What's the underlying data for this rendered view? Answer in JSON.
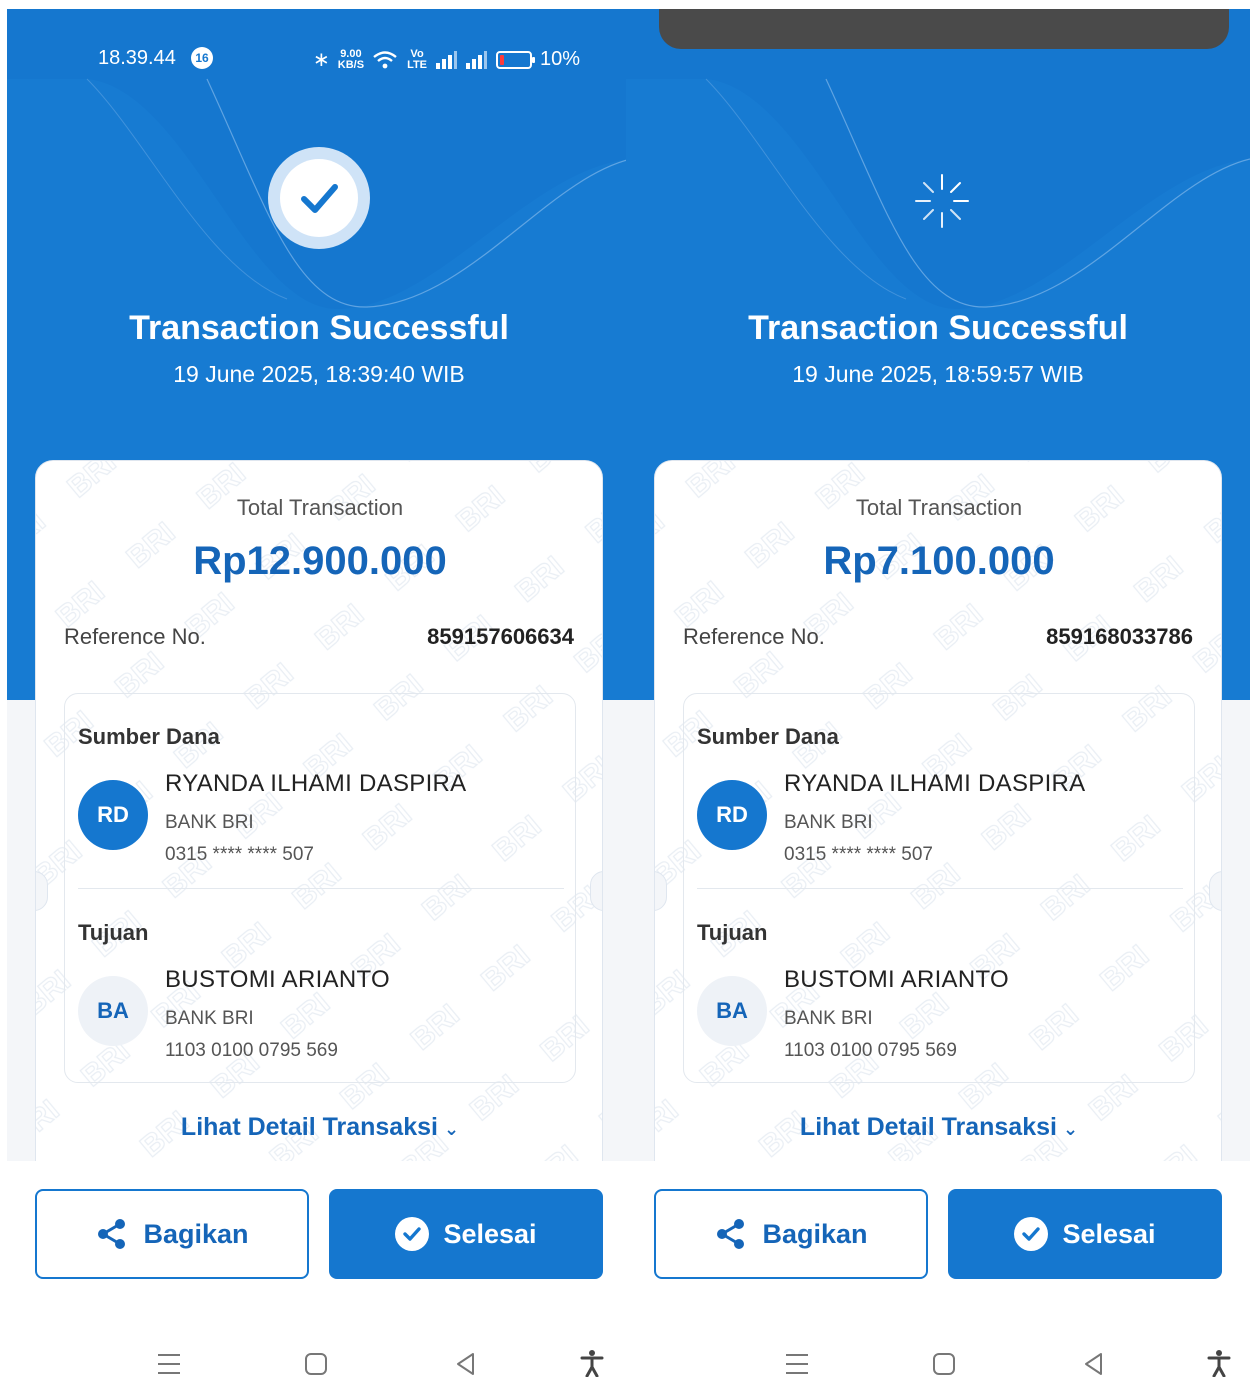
{
  "status_bar": {
    "time": "18.39.44",
    "notif_count": "16",
    "net_speed_top": "9.00",
    "net_speed_unit": "KB/S",
    "volte": "Vo LTE",
    "battery": "10%"
  },
  "colors": {
    "brand_blue": "#1577cf",
    "amount_blue": "#1565b8",
    "background": "#f4f6f9"
  },
  "screens": [
    {
      "title": "Transaction Successful",
      "datetime": "19 June 2025, 18:39:40 WIB",
      "status_icon": "checkmark-icon",
      "total_label": "Total Transaction",
      "total_amount": "Rp12.900.000",
      "reference_label": "Reference No.",
      "reference_value": "859157606634",
      "source": {
        "label": "Sumber Dana",
        "initials": "RD",
        "name": "RYANDA ILHAMI DASPIRA",
        "bank": "BANK BRI",
        "account": "0315 **** **** 507"
      },
      "destination": {
        "label": "Tujuan",
        "initials": "BA",
        "name": "BUSTOMI ARIANTO",
        "bank": "BANK BRI",
        "account": "1103 0100 0795 569"
      },
      "detail_link": "Lihat Detail Transaksi",
      "share_label": "Bagikan",
      "done_label": "Selesai"
    },
    {
      "title": "Transaction Successful",
      "datetime": "19 June 2025, 18:59:57 WIB",
      "status_icon": "loading-spinner-icon",
      "total_label": "Total Transaction",
      "total_amount": "Rp7.100.000",
      "reference_label": "Reference No.",
      "reference_value": "859168033786",
      "source": {
        "label": "Sumber Dana",
        "initials": "RD",
        "name": "RYANDA ILHAMI DASPIRA",
        "bank": "BANK BRI",
        "account": "0315 **** **** 507"
      },
      "destination": {
        "label": "Tujuan",
        "initials": "BA",
        "name": "BUSTOMI ARIANTO",
        "bank": "BANK BRI",
        "account": "1103 0100 0795 569"
      },
      "detail_link": "Lihat Detail Transaksi",
      "share_label": "Bagikan",
      "done_label": "Selesai"
    }
  ],
  "watermark_text": "BRI",
  "nav_bar": [
    "menu-icon",
    "home-icon",
    "back-icon",
    "accessibility-icon"
  ]
}
